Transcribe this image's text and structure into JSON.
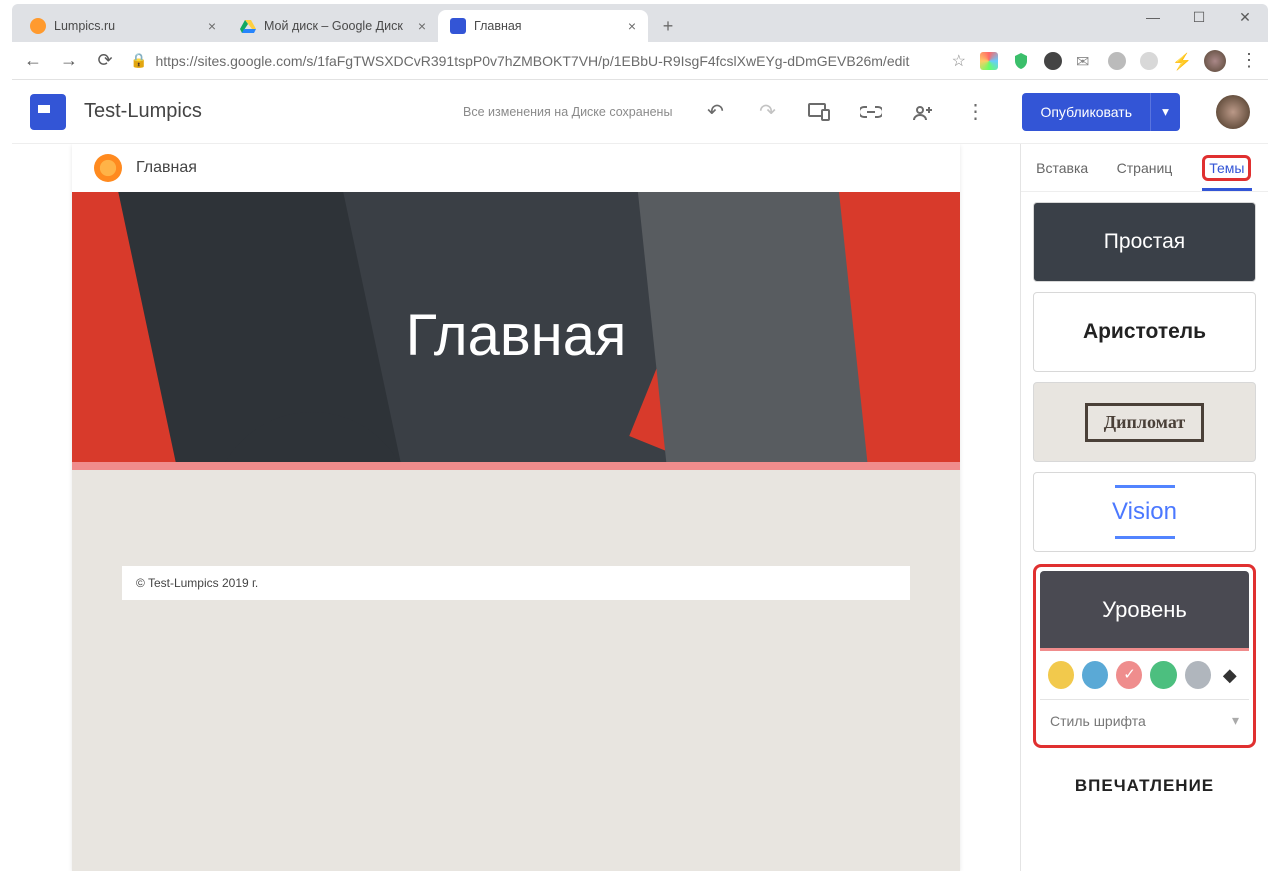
{
  "browser": {
    "tabs": [
      {
        "title": "Lumpics.ru",
        "favicon": "#ff9a2e"
      },
      {
        "title": "Мой диск – Google Диск",
        "favicon": "gdrive"
      },
      {
        "title": "Главная",
        "favicon": "gsites",
        "active": true
      }
    ],
    "url": "https://sites.google.com/s/1faFgTWSXDCvR391tspP0v7hZMBOKT7VH/p/1EBbU-R9IsgF4fcslXwEYg-dDmGEVB26m/edit"
  },
  "app": {
    "title": "Test-Lumpics",
    "save_status": "Все изменения на Диске сохранены",
    "publish_label": "Опубликовать"
  },
  "page": {
    "nav_title": "Главная",
    "hero_title": "Главная",
    "footer": "© Test-Lumpics 2019 г."
  },
  "sidebar": {
    "tabs": {
      "insert": "Вставка",
      "pages": "Страниц",
      "themes": "Темы"
    },
    "themes": {
      "simple": "Простая",
      "aristotle": "Аристотель",
      "diplomat": "Дипломат",
      "vision": "Vision",
      "level": "Уровень",
      "last": "ВПЕЧАТЛЕНИЕ"
    },
    "font_style_label": "Стиль шрифта",
    "colors": [
      "#f2c94c",
      "#5aa9d6",
      "#ef8d8d",
      "#4cbf7f",
      "#b0b6bd"
    ]
  }
}
